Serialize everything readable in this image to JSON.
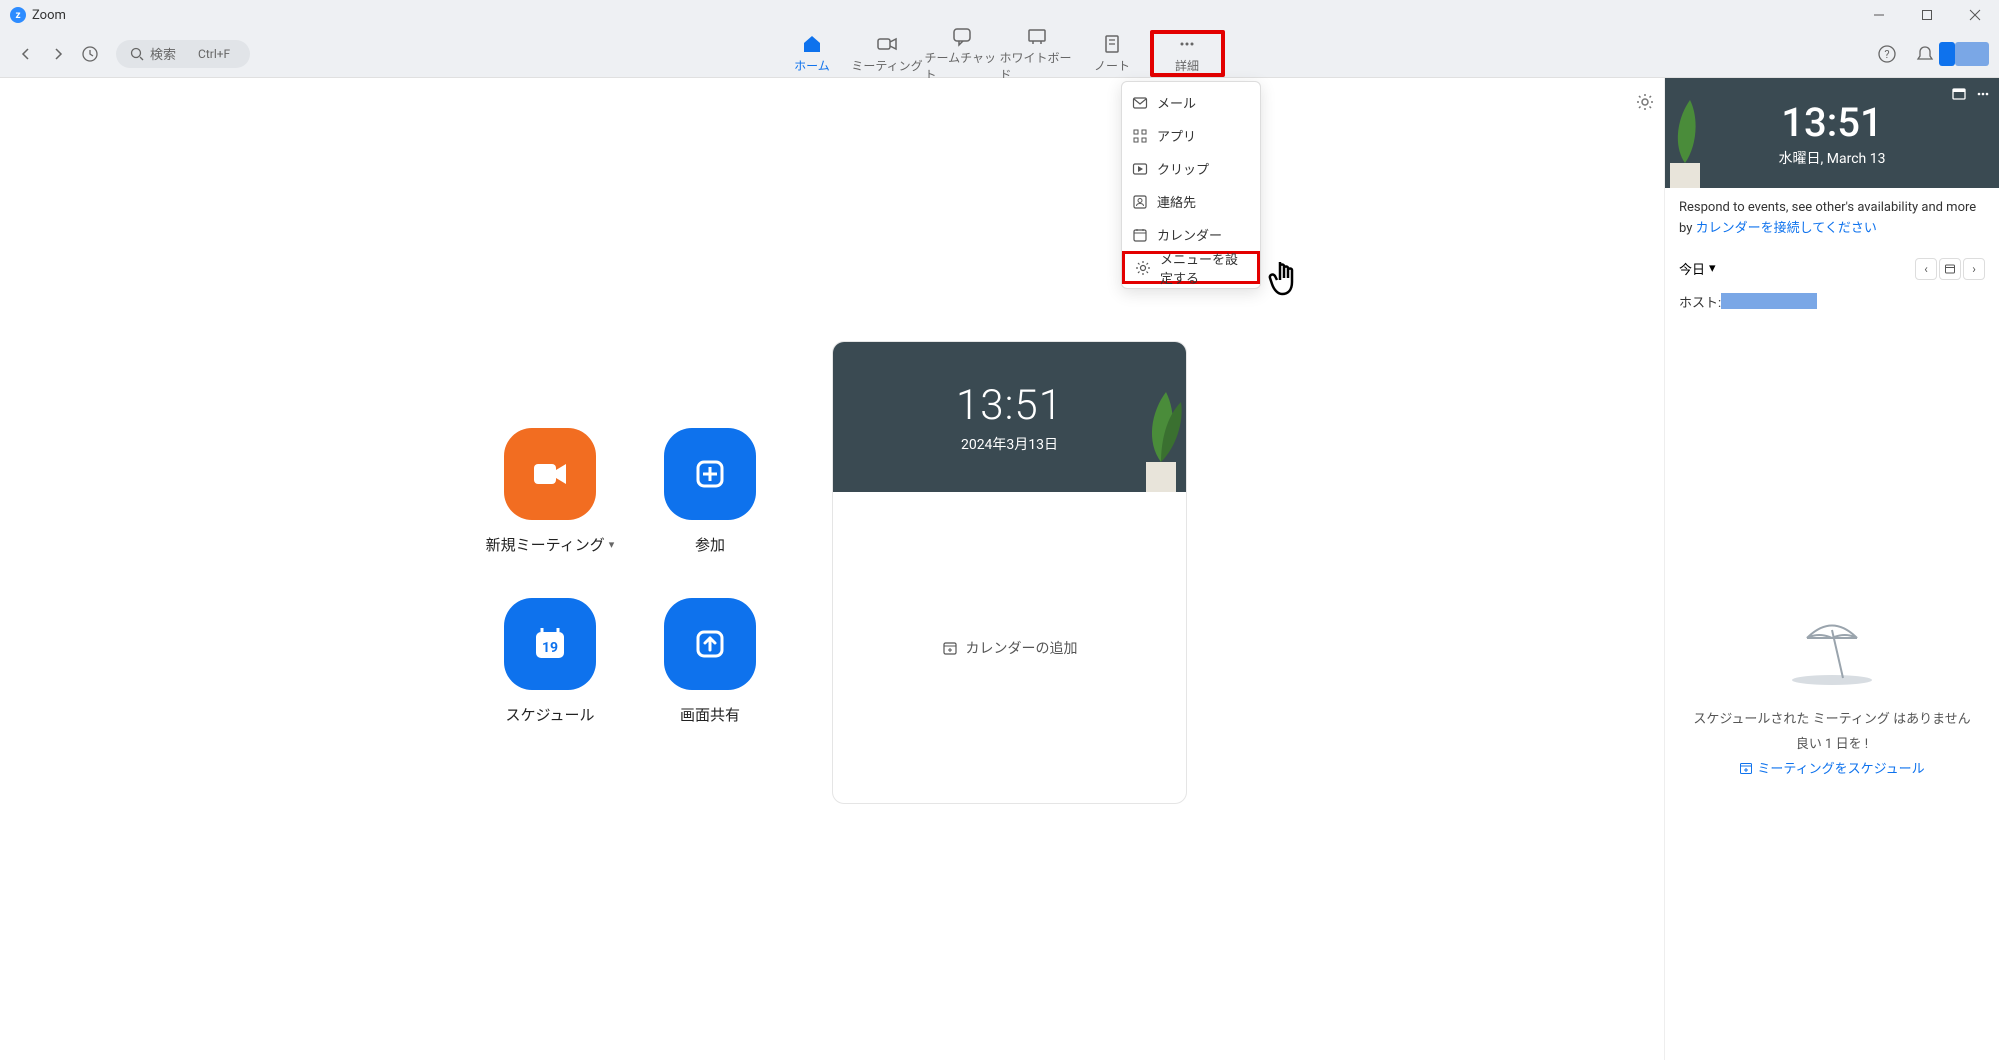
{
  "window": {
    "title": "Zoom"
  },
  "search": {
    "placeholder": "検索",
    "shortcut": "Ctrl+F"
  },
  "nav": {
    "home": "ホーム",
    "meetings": "ミーティング",
    "teamchat": "チームチャット",
    "whiteboard": "ホワイトボード",
    "notes": "ノート",
    "more": "詳細"
  },
  "dropdown": {
    "mail": "メール",
    "apps": "アプリ",
    "clips": "クリップ",
    "contacts": "連絡先",
    "calendar": "カレンダー",
    "set_menu": "メニューを設定する"
  },
  "tiles": {
    "new_meeting": "新規ミーティング",
    "join": "参加",
    "schedule": "スケジュール",
    "screen_share": "画面共有",
    "cal_day": "19"
  },
  "calcard": {
    "time": "13:51",
    "date": "2024年3月13日",
    "add_calendar": "カレンダーの追加"
  },
  "sidebar": {
    "time": "13:51",
    "date": "水曜日, March 13",
    "info_pre": "Respond to events, see other's availability and more by ",
    "info_link": "カレンダーを接続してください",
    "today": "今日",
    "host_label": "ホスト:",
    "empty1": "スケジュールされた ミーティング はありません",
    "empty2": "良い 1 日を !",
    "schedule_link": "ミーティングをスケジュール"
  }
}
